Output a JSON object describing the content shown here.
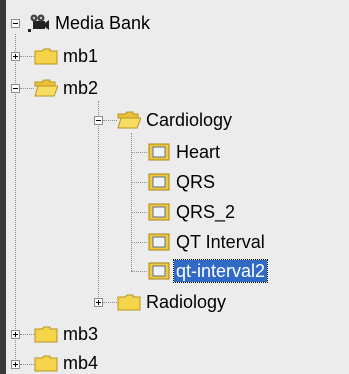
{
  "tree": {
    "root": {
      "label": "Media Bank",
      "icon": "video-camera-icon"
    },
    "mb1": {
      "label": "mb1",
      "icon": "folder-icon"
    },
    "mb2": {
      "label": "mb2",
      "icon": "folder-open-icon"
    },
    "cardiology": {
      "label": "Cardiology",
      "icon": "folder-open-icon"
    },
    "items": [
      {
        "label": "Heart",
        "icon": "media-item-icon"
      },
      {
        "label": "QRS",
        "icon": "media-item-icon"
      },
      {
        "label": "QRS_2",
        "icon": "media-item-icon"
      },
      {
        "label": "QT Interval",
        "icon": "media-item-icon"
      },
      {
        "label": "qt-interval2",
        "icon": "media-item-icon",
        "selected": true
      }
    ],
    "radiology": {
      "label": "Radiology",
      "icon": "folder-icon"
    },
    "mb3": {
      "label": "mb3",
      "icon": "folder-icon"
    },
    "mb4": {
      "label": "mb4",
      "icon": "folder-icon"
    }
  },
  "colors": {
    "selection": "#316ac5",
    "folder": "#f5d44a",
    "border": "#3a3a3a"
  }
}
